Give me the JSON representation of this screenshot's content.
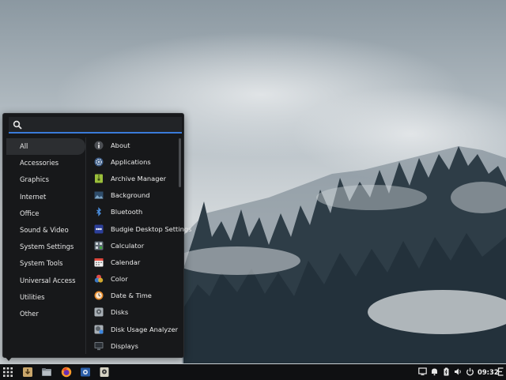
{
  "search": {
    "placeholder": ""
  },
  "categories": [
    "All",
    "Accessories",
    "Graphics",
    "Internet",
    "Office",
    "Sound & Video",
    "System Settings",
    "System Tools",
    "Universal Access",
    "Utilities",
    "Other"
  ],
  "apps": [
    {
      "label": "About",
      "icon": "info-icon"
    },
    {
      "label": "Applications",
      "icon": "gear-icon"
    },
    {
      "label": "Archive Manager",
      "icon": "archive-icon"
    },
    {
      "label": "Background",
      "icon": "background-icon"
    },
    {
      "label": "Bluetooth",
      "icon": "bluetooth-icon"
    },
    {
      "label": "Budgie Desktop Settings",
      "icon": "budgie-settings-icon"
    },
    {
      "label": "Calculator",
      "icon": "calculator-icon"
    },
    {
      "label": "Calendar",
      "icon": "calendar-icon"
    },
    {
      "label": "Color",
      "icon": "color-icon"
    },
    {
      "label": "Date & Time",
      "icon": "clock-icon"
    },
    {
      "label": "Disks",
      "icon": "disks-icon"
    },
    {
      "label": "Disk Usage Analyzer",
      "icon": "disk-usage-icon"
    },
    {
      "label": "Displays",
      "icon": "display-icon"
    }
  ],
  "panel": {
    "clock": "09:32",
    "launchers": [
      "apps-grid-icon",
      "installer-icon",
      "files-icon",
      "firefox-icon",
      "software-icon",
      "archive-icon"
    ],
    "tray": [
      "screen-icon",
      "bell-icon",
      "battery-icon",
      "volume-icon",
      "power-icon",
      "raven-icon"
    ]
  },
  "colors": {
    "accent": "#3a7ad9",
    "menu_bg": "#17181a",
    "panel_bg": "#0f1012"
  }
}
